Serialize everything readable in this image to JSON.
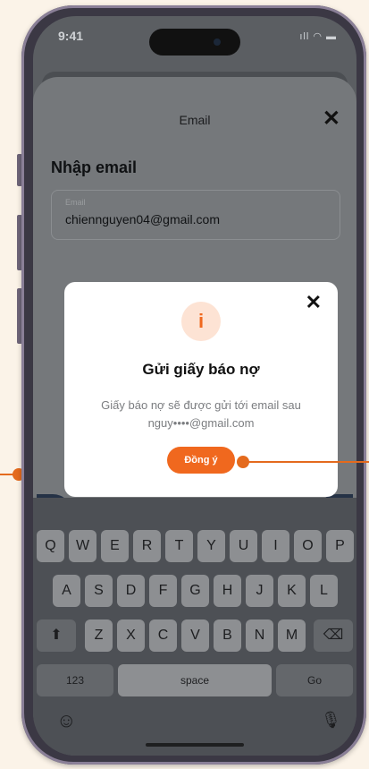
{
  "status_bar": {
    "time": "9:41",
    "icons": "ıll ◠ ▬"
  },
  "sheet": {
    "title": "Email",
    "close_glyph": "✕",
    "heading": "Nhập email"
  },
  "email_field": {
    "label": "Email",
    "value": "chiennguyen04@gmail.com"
  },
  "dialog": {
    "icon_glyph": "i",
    "close_glyph": "✕",
    "title": "Gửi giấy báo nợ",
    "message_line1": "Giấy báo nợ sẽ được gửi tới email sau",
    "message_line2": "nguy••••@gmail.com",
    "confirm_label": "Đồng ý"
  },
  "keyboard": {
    "row1": [
      "Q",
      "W",
      "E",
      "R",
      "T",
      "Y",
      "U",
      "I",
      "O",
      "P"
    ],
    "row2": [
      "A",
      "S",
      "D",
      "F",
      "G",
      "H",
      "J",
      "K",
      "L"
    ],
    "row3": [
      "Z",
      "X",
      "C",
      "V",
      "B",
      "N",
      "M"
    ],
    "numbers_label": "123",
    "space_label": "space",
    "go_label": "Go",
    "shift_glyph": "⬆",
    "delete_glyph": "⌫",
    "emoji_glyph": "☺",
    "mic_glyph": "🎙"
  },
  "colors": {
    "accent": "#f0681e",
    "pointer": "#e46a1d",
    "dialog_icon_bg": "#fde3d4"
  }
}
